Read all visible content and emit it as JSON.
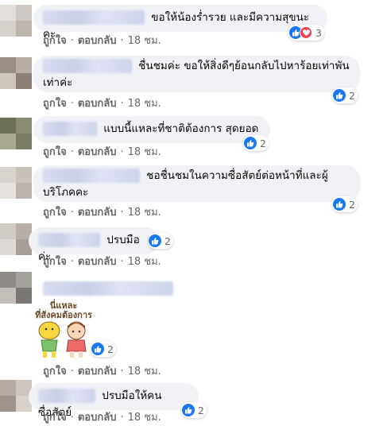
{
  "comments": [
    {
      "message": "ขอให้น้องร่ำรวย และมีความสุขนะคะ",
      "actions": {
        "like": "ถูกใจ",
        "reply": "ตอบกลับ",
        "time": "18 ชม."
      },
      "reactions": {
        "types": [
          "like-icon",
          "heart-icon"
        ],
        "count": "3"
      },
      "avatar_colors": [
        "#e3e0dc",
        "#cfc9c3",
        "#d6d1cb",
        "#bdb6ae"
      ]
    },
    {
      "message": "ชื่นชมค่ะ ขอให้สิ่งดีๆย้อนกลับไปหาร้อยเท่าพันเท่าค่ะ",
      "actions": {
        "like": "ถูกใจ",
        "reply": "ตอบกลับ",
        "time": "18 ชม."
      },
      "reactions": {
        "types": [
          "like-icon"
        ],
        "count": "2"
      },
      "avatar_colors": [
        "#9a8f86",
        "#b9aea3",
        "#cfc6bd",
        "#8c8076"
      ]
    },
    {
      "message": "แบบนี้แหละที่ชาติต้องการ สุดยอด",
      "actions": {
        "like": "ถูกใจ",
        "reply": "ตอบกลับ",
        "time": "18 ชม."
      },
      "reactions": {
        "types": [
          "like-icon"
        ],
        "count": "2"
      },
      "avatar_colors": [
        "#6f705a",
        "#8b8a73",
        "#a9a893",
        "#7d7c66"
      ]
    },
    {
      "message": "ชอชื่นชมในความซื่อสัตย์ต่อหน้าที่และผู้บริโภคคะ",
      "actions": {
        "like": "ถูกใจ",
        "reply": "ตอบกลับ",
        "time": "18 ชม."
      },
      "reactions": {
        "types": [
          "like-icon"
        ],
        "count": "2"
      },
      "avatar_colors": [
        "#d9d4cd",
        "#c7c1b9",
        "#e4e0db",
        "#bbb4ac"
      ]
    },
    {
      "message": "ปรบมือค่ะ",
      "actions": {
        "like": "ถูกใจ",
        "reply": "ตอบกลับ",
        "time": "18 ชม."
      },
      "reactions": {
        "types": [
          "like-icon"
        ],
        "count": "2"
      },
      "avatar_colors": [
        "#cfcac4",
        "#b5afa8",
        "#ddd9d4",
        "#a59f98"
      ]
    },
    {
      "message": "",
      "sticker_text": "นี่แหละ ที่สังคมต้องการ",
      "actions": {
        "like": "ถูกใจ",
        "reply": "ตอบกลับ",
        "time": "18 ชม."
      },
      "reactions": {
        "types": [
          "like-icon"
        ],
        "count": "2"
      },
      "avatar_colors": [
        "#8e8b86",
        "#a5a19b",
        "#c2beb8",
        "#7a7671"
      ]
    },
    {
      "message": "ปรบมือให้คนซื่อสัตย์",
      "actions": {
        "like": "ถูกใจ",
        "reply": "ตอบกลับ",
        "time": "18 ชม."
      },
      "reactions": {
        "types": [
          "like-icon"
        ],
        "count": "2"
      },
      "avatar_colors": [
        "#b6aaa3",
        "#cfc5bf",
        "#9f9289",
        "#d9d1cc"
      ]
    }
  ],
  "colors": {
    "bubble": "#f0f2f5",
    "like": "#1877f2",
    "heart": "#f33e58",
    "meta": "#65676b"
  }
}
